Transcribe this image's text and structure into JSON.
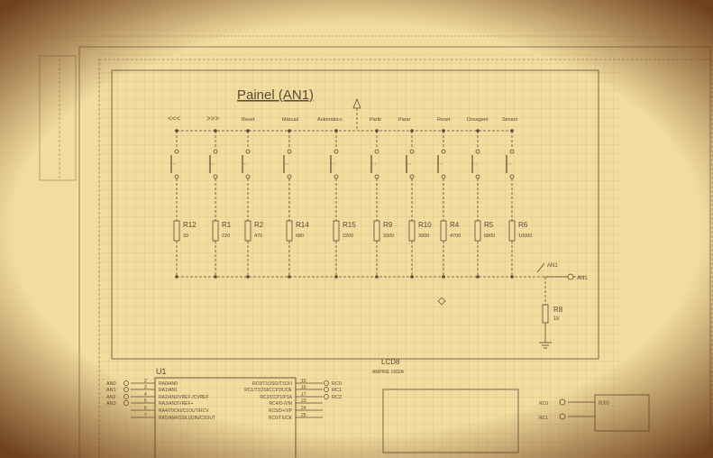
{
  "panel": {
    "title": "Painel (AN1)",
    "button_labels": [
      "<<<",
      ">>>",
      "Reset",
      "Manual",
      "Automático",
      "Partir",
      "Parar",
      "Reset",
      "Dosagem",
      "Sensor"
    ],
    "resistors": [
      {
        "ref": "R12",
        "value": "33"
      },
      {
        "ref": "R1",
        "value": "220"
      },
      {
        "ref": "R2",
        "value": "470"
      },
      {
        "ref": "R14",
        "value": "680"
      },
      {
        "ref": "R15",
        "value": "2200"
      },
      {
        "ref": "R9",
        "value": "3300"
      },
      {
        "ref": "R10",
        "value": "3900"
      },
      {
        "ref": "R4",
        "value": "4700"
      },
      {
        "ref": "R5",
        "value": "6800"
      },
      {
        "ref": "R6",
        "value": "10000"
      }
    ],
    "output_label": "AN1",
    "net_label": "AN1",
    "pulldown": {
      "ref": "R8",
      "value": "1k"
    }
  },
  "box_label": "LCD8",
  "box_sublabel": "AMPIRE 1602A",
  "u1": {
    "ref": "U1",
    "left_nets": [
      "AN0",
      "AN1",
      "AN2",
      "AN3"
    ],
    "left_pins": [
      "2",
      "3",
      "4",
      "5",
      "6",
      "7"
    ],
    "left_pin_names": [
      "RA0/AN0",
      "RA1/AN1",
      "RA2/AN2/VREF-/CVREF",
      "RA3/AN3/VREF+",
      "RA4/T0CKI/C1OUT/RCV",
      "RA5/AN4/SS/LVDIN/C2OUT"
    ],
    "right_pin_names": [
      "RC0/T1OSO/T1CKI",
      "RC1/T1OSI/CCP2/UOE",
      "RC2/CCP1/P1A",
      "RC4/D-/VM",
      "RC5/D+/VP",
      "RC6/TX/CK"
    ],
    "right_pins": [
      "15",
      "16",
      "17",
      "23",
      "24",
      "25"
    ],
    "right_nets": [
      "RC0",
      "RC1",
      "RC2"
    ]
  },
  "right_nets": [
    "RC0",
    "RC1"
  ],
  "rx_label": "RX0",
  "colors": {
    "paper": "#f2dc9e",
    "ink": "#5a4a36",
    "burn": "#6e3e1a"
  }
}
